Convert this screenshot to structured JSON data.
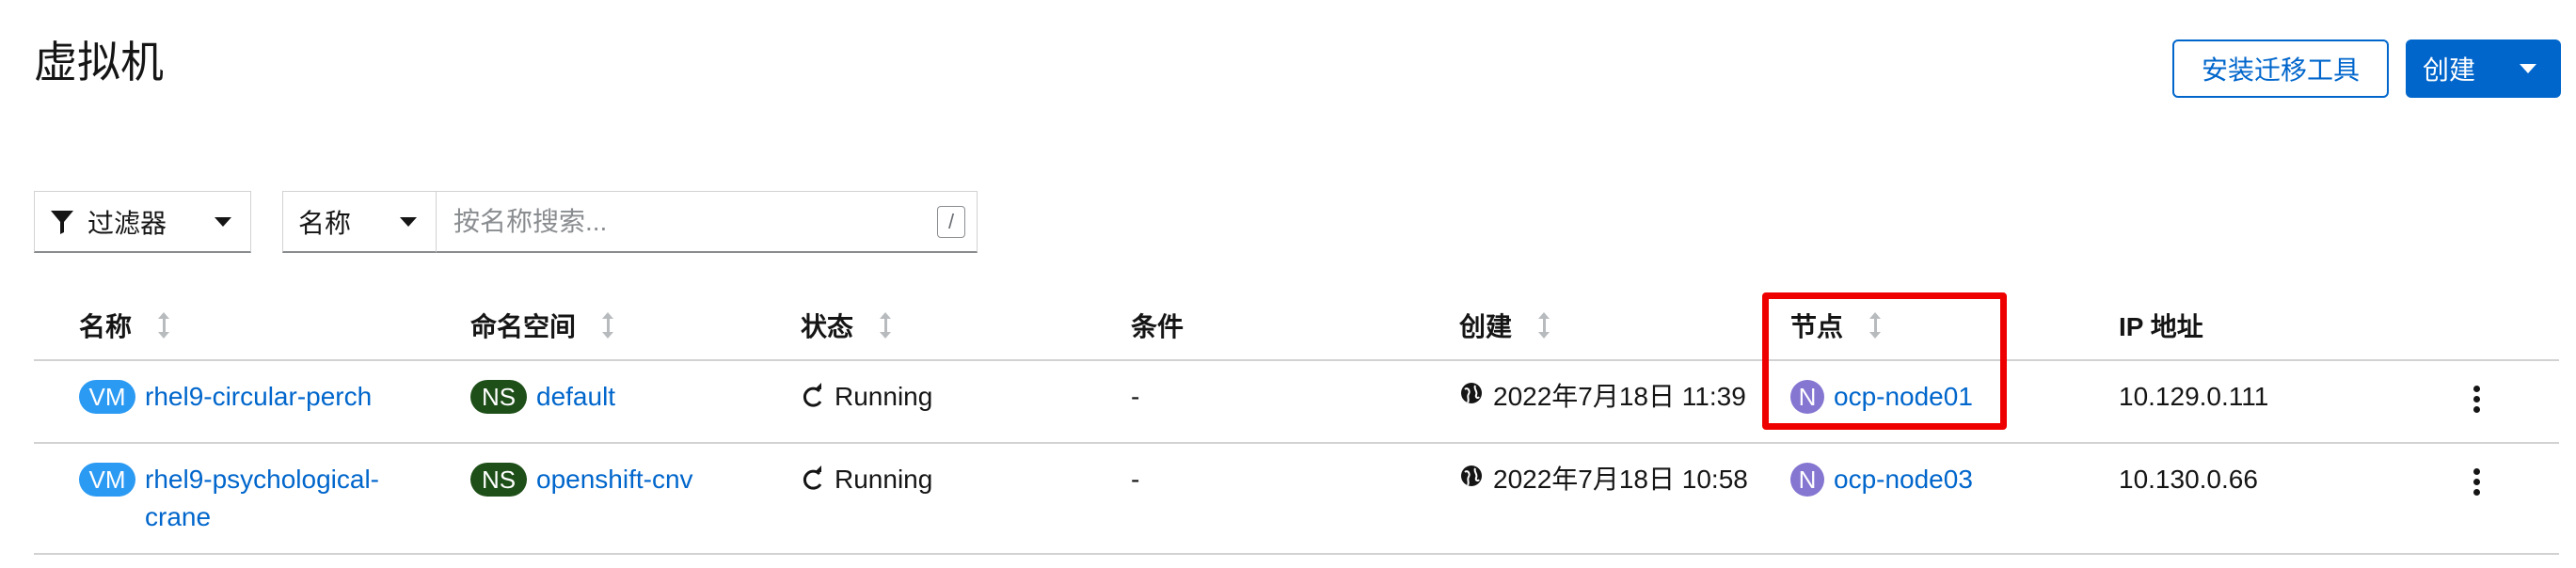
{
  "header": {
    "title": "虚拟机",
    "install_label": "安装迁移工具",
    "create_label": "创建"
  },
  "toolbar": {
    "filter_label": "过滤器",
    "attribute_label": "名称",
    "search_placeholder": "按名称搜索...",
    "slash_hint": "/"
  },
  "table": {
    "columns": [
      "名称",
      "命名空间",
      "状态",
      "条件",
      "创建",
      "节点",
      "IP 地址"
    ],
    "rows": [
      {
        "vm_badge": "VM",
        "name": "rhel9-circular-perch",
        "ns_badge": "NS",
        "namespace": "default",
        "status": "Running",
        "conditions": "-",
        "created": "2022年7月18日 11:39",
        "node_badge": "N",
        "node": "ocp-node01",
        "ip": "10.129.0.111"
      },
      {
        "vm_badge": "VM",
        "name": "rhel9-psychological-crane",
        "ns_badge": "NS",
        "namespace": "openshift-cnv",
        "status": "Running",
        "conditions": "-",
        "created": "2022年7月18日 10:58",
        "node_badge": "N",
        "node": "ocp-node03",
        "ip": "10.130.0.66"
      }
    ]
  },
  "colors": {
    "link": "#0066cc",
    "vm_badge": "#2b9af3",
    "ns_badge": "#1e4f18",
    "node_badge": "#8476d1",
    "highlight": "#ee0000"
  },
  "icons": {
    "filter": "filter-icon",
    "sort": "sort-icon",
    "status": "sync-icon",
    "created": "globe-icon",
    "actions": "kebab-icon"
  }
}
